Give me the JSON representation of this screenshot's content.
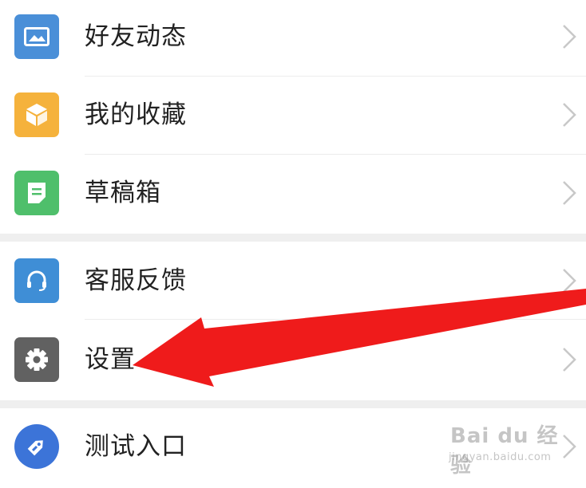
{
  "menu": {
    "items": [
      {
        "label": "好友动态",
        "icon": "photo-icon",
        "color": "#4a8fd8"
      },
      {
        "label": "我的收藏",
        "icon": "box-icon",
        "color": "#f5b23c"
      },
      {
        "label": "草稿箱",
        "icon": "document-icon",
        "color": "#4fbf6b"
      },
      {
        "label": "客服反馈",
        "icon": "headset-icon",
        "color": "#3f8ed6"
      },
      {
        "label": "设置",
        "icon": "gear-icon",
        "color": "#616161"
      },
      {
        "label": "测试入口",
        "icon": "tag-icon",
        "color": "#3c74d8"
      }
    ]
  },
  "annotation": {
    "arrow_color": "#ef1b1b",
    "arrow_points_to": "设置"
  },
  "watermark": {
    "main": "Bai du 经验",
    "sub": "jingyan.baidu.com"
  }
}
